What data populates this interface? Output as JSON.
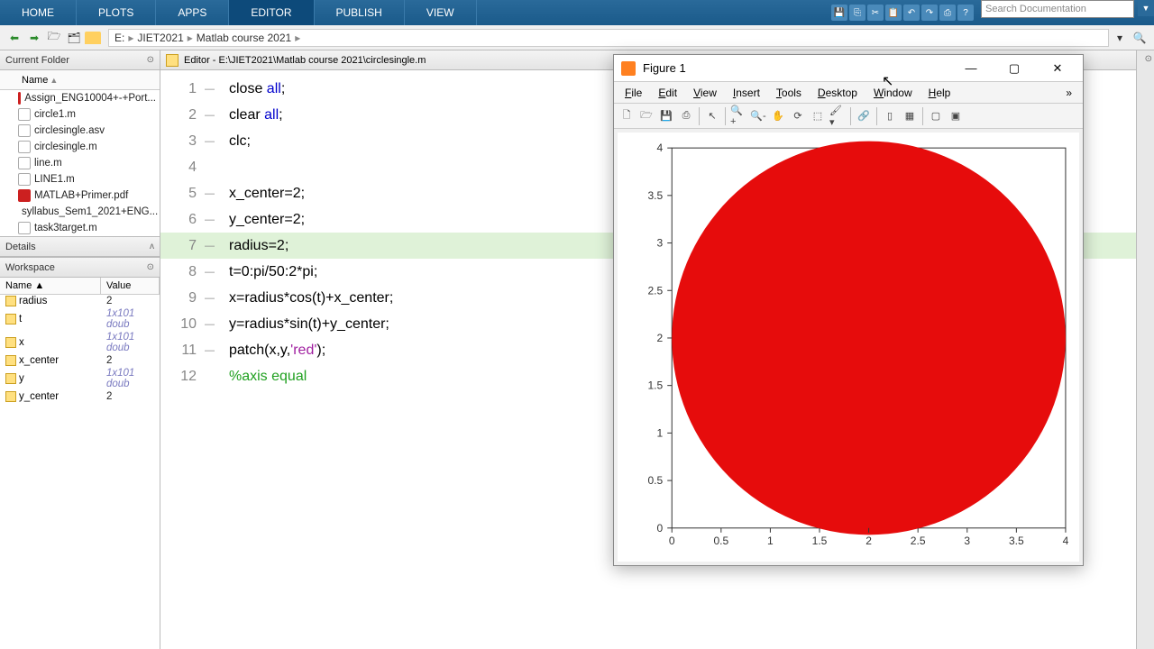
{
  "ribbon": {
    "tabs": [
      "HOME",
      "PLOTS",
      "APPS",
      "EDITOR",
      "PUBLISH",
      "VIEW"
    ],
    "active": 3,
    "search_placeholder": "Search Documentation"
  },
  "breadcrumb": [
    "E:",
    "JIET2021",
    "Matlab course 2021"
  ],
  "panels": {
    "current_folder": "Current Folder",
    "name_col": "Name",
    "details": "Details",
    "workspace": "Workspace"
  },
  "files": [
    {
      "name": "Assign_ENG10004+-+Port...",
      "type": "pdf"
    },
    {
      "name": "circle1.m",
      "type": "m"
    },
    {
      "name": "circlesingle.asv",
      "type": "m"
    },
    {
      "name": "circlesingle.m",
      "type": "m"
    },
    {
      "name": "line.m",
      "type": "m"
    },
    {
      "name": "LINE1.m",
      "type": "m"
    },
    {
      "name": "MATLAB+Primer.pdf",
      "type": "pdf"
    },
    {
      "name": "syllabus_Sem1_2021+ENG...",
      "type": "pdf"
    },
    {
      "name": "task3target.m",
      "type": "m"
    }
  ],
  "workspace": {
    "cols": [
      "Name ▲",
      "Value"
    ],
    "rows": [
      {
        "name": "radius",
        "value": "2",
        "dim": false
      },
      {
        "name": "t",
        "value": "1x101 doub",
        "dim": true
      },
      {
        "name": "x",
        "value": "1x101 doub",
        "dim": true
      },
      {
        "name": "x_center",
        "value": "2",
        "dim": false
      },
      {
        "name": "y",
        "value": "1x101 doub",
        "dim": true
      },
      {
        "name": "y_center",
        "value": "2",
        "dim": false
      }
    ]
  },
  "editor": {
    "title": "Editor - E:\\JIET2021\\Matlab course 2021\\circlesingle.m",
    "lines": [
      {
        "n": 1,
        "seg": [
          {
            "t": "close ",
            "c": ""
          },
          {
            "t": "all",
            "c": "kw"
          },
          {
            "t": ";",
            "c": ""
          }
        ]
      },
      {
        "n": 2,
        "seg": [
          {
            "t": "clear ",
            "c": ""
          },
          {
            "t": "all",
            "c": "kw"
          },
          {
            "t": ";",
            "c": ""
          }
        ]
      },
      {
        "n": 3,
        "seg": [
          {
            "t": "clc;",
            "c": ""
          }
        ]
      },
      {
        "n": 4,
        "seg": [],
        "nomarks": true
      },
      {
        "n": 5,
        "seg": [
          {
            "t": "x_center=2;",
            "c": ""
          }
        ]
      },
      {
        "n": 6,
        "seg": [
          {
            "t": "y_center=2;",
            "c": ""
          }
        ]
      },
      {
        "n": 7,
        "seg": [
          {
            "t": "radius=2;",
            "c": ""
          }
        ],
        "hl": true
      },
      {
        "n": 8,
        "seg": [
          {
            "t": "t=0:pi/50:2*pi;",
            "c": ""
          }
        ]
      },
      {
        "n": 9,
        "seg": [
          {
            "t": "x=radius*cos(t)+x_center;",
            "c": ""
          }
        ]
      },
      {
        "n": 10,
        "seg": [
          {
            "t": "y=radius*sin(t)+y_center;",
            "c": ""
          }
        ]
      },
      {
        "n": 11,
        "seg": [
          {
            "t": "patch(x,y,",
            "c": ""
          },
          {
            "t": "'red'",
            "c": "str"
          },
          {
            "t": ");",
            "c": ""
          }
        ]
      },
      {
        "n": 12,
        "seg": [
          {
            "t": "%axis equal",
            "c": "com"
          }
        ],
        "nomarks": true
      }
    ]
  },
  "figure": {
    "title": "Figure 1",
    "menu": [
      "File",
      "Edit",
      "View",
      "Insert",
      "Tools",
      "Desktop",
      "Window",
      "Help"
    ]
  },
  "chart_data": {
    "type": "area",
    "shape": "circle",
    "x_center": 2,
    "y_center": 2,
    "radius": 2,
    "fill": "#e60c0c",
    "xlim": [
      0,
      4
    ],
    "ylim": [
      0,
      4
    ],
    "xticks": [
      0,
      0.5,
      1,
      1.5,
      2,
      2.5,
      3,
      3.5,
      4
    ],
    "yticks": [
      0,
      0.5,
      1,
      1.5,
      2,
      2.5,
      3,
      3.5,
      4
    ],
    "title": "",
    "xlabel": "",
    "ylabel": ""
  }
}
